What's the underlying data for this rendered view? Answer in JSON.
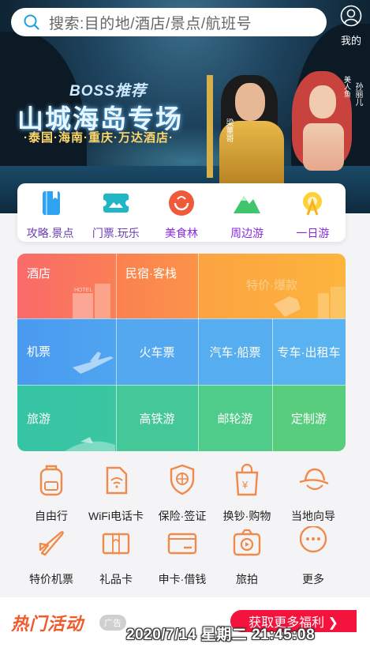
{
  "search": {
    "placeholder": "搜索:目的地/酒店/景点/航班号"
  },
  "header": {
    "me_label": "我的"
  },
  "banner": {
    "tag": "BOSS推荐",
    "title": "山城海岛专场",
    "subtitle": "·泰国·海南·重庆·万达酒店·",
    "person_right": "孙丽儿",
    "person_right_prefix": "美人鱼",
    "person_left": "梁董哥"
  },
  "quick_nav": [
    {
      "label": "攻略.景点",
      "icon": "guide-book-icon",
      "color": "#2fa3f0"
    },
    {
      "label": "门票.玩乐",
      "icon": "ticket-icon",
      "color": "#20b6c6"
    },
    {
      "label": "美食林",
      "icon": "food-icon",
      "color": "#f0593a"
    },
    {
      "label": "周边游",
      "icon": "mountain-icon",
      "color": "#3fc66a"
    },
    {
      "label": "一日游",
      "icon": "ferris-wheel-icon",
      "color": "#f7b21d"
    }
  ],
  "grid": {
    "row1": {
      "hotel": "酒店",
      "homestay": "民宿·客栈",
      "deals": "特价·爆款"
    },
    "row2": {
      "flight": "机票",
      "train": "火车票",
      "bus": "汽车·船票",
      "car": "专车·出租车"
    },
    "row3": {
      "travel": "旅游",
      "hsr": "高铁游",
      "cruise": "邮轮游",
      "custom": "定制游"
    }
  },
  "services": [
    {
      "label": "自由行",
      "icon": "backpack-icon"
    },
    {
      "label": "WiFi电话卡",
      "icon": "wifi-card-icon"
    },
    {
      "label": "保险·签证",
      "icon": "insurance-shield-icon"
    },
    {
      "label": "换钞·购物",
      "icon": "shopping-bag-icon"
    },
    {
      "label": "当地向导",
      "icon": "guide-hat-icon"
    },
    {
      "label": "特价机票",
      "icon": "airplane-icon"
    },
    {
      "label": "礼品卡",
      "icon": "gift-card-icon"
    },
    {
      "label": "申卡·借钱",
      "icon": "credit-card-icon"
    },
    {
      "label": "旅拍",
      "icon": "camera-icon"
    },
    {
      "label": "更多",
      "icon": "more-dots-icon"
    }
  ],
  "hot": {
    "title": "热门活动",
    "ad_label": "广告",
    "more_label": "获取更多福利 ❯"
  },
  "overlay": {
    "timestamp": "2020/7/14 星期二 21:45:08"
  },
  "colors": {
    "accent": "#f4133c",
    "orange": "#f08a4b",
    "purple": "#6a3fb0"
  }
}
